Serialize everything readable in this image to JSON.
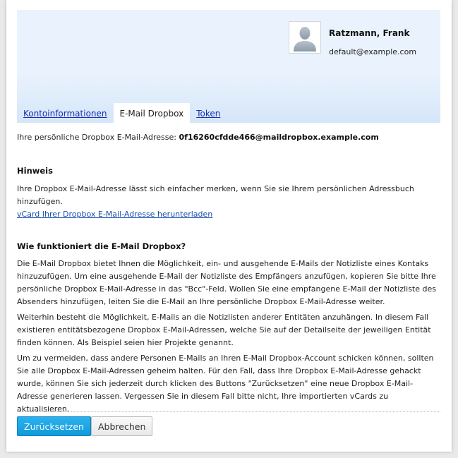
{
  "user": {
    "name": "Ratzmann, Frank",
    "email": "default@example.com"
  },
  "tabs": [
    {
      "label": "Kontoinformationen",
      "active": false
    },
    {
      "label": "E-Mail Dropbox",
      "active": true
    },
    {
      "label": "Token",
      "active": false
    }
  ],
  "dropbox": {
    "address_label": "Ihre persönliche Dropbox E-Mail-Adresse: ",
    "address": "0f16260cfdde466@maildropbox.example.com"
  },
  "hint": {
    "title": "Hinweis",
    "text": "Ihre Dropbox E-Mail-Adresse lässt sich einfacher merken, wenn Sie sie Ihrem persönlichen Adressbuch hinzufügen.",
    "link": "vCard Ihrer Dropbox E-Mail-Adresse herunterladen"
  },
  "howto": {
    "title": "Wie funktioniert die E-Mail Dropbox?",
    "paragraphs": [
      "Die E-Mail Dropbox bietet Ihnen die Möglichkeit, ein- und ausgehende E-Mails der Notizliste eines Kontaks hinzuzufügen. Um eine ausgehende E-Mail der Notizliste des Empfängers anzufügen, kopieren Sie bitte Ihre persönliche Dropbox E-Mail-Adresse in das \"Bcc\"-Feld. Wollen Sie eine empfangene E-Mail der Notizliste des Absenders hinzufügen, leiten Sie die E-Mail an Ihre persönliche Dropbox E-Mail-Adresse weiter.",
      "Weiterhin besteht die Möglichkeit, E-Mails an die Notizlisten anderer Entitäten anzuhängen. In diesem Fall existieren entitätsbezogene Dropbox E-Mail-Adressen, welche Sie auf der Detailseite der jeweiligen Entität finden können. Als Beispiel seien hier Projekte genannt.",
      "Um zu vermeiden, dass andere Personen E-Mails an Ihren E-Mail Dropbox-Account schicken können, sollten Sie alle Dropbox E-Mail-Adressen geheim halten. Für den Fall, dass Ihre Dropbox E-Mail-Adresse gehackt wurde, können Sie sich jederzeit durch klicken des Buttons \"Zurücksetzen\" eine neue Dropbox E-Mail-Adresse generieren lassen. Vergessen Sie in diesem Fall bitte nicht, Ihre importierten vCards zu aktualisieren."
    ]
  },
  "buttons": {
    "reset": "Zurücksetzen",
    "cancel": "Abbrechen"
  },
  "icons": {
    "avatar": "user-silhouette-icon"
  },
  "colors": {
    "primary_button": "#1aa6e6",
    "link": "#1a2fb0",
    "header_bg": "#eaf3fd"
  }
}
